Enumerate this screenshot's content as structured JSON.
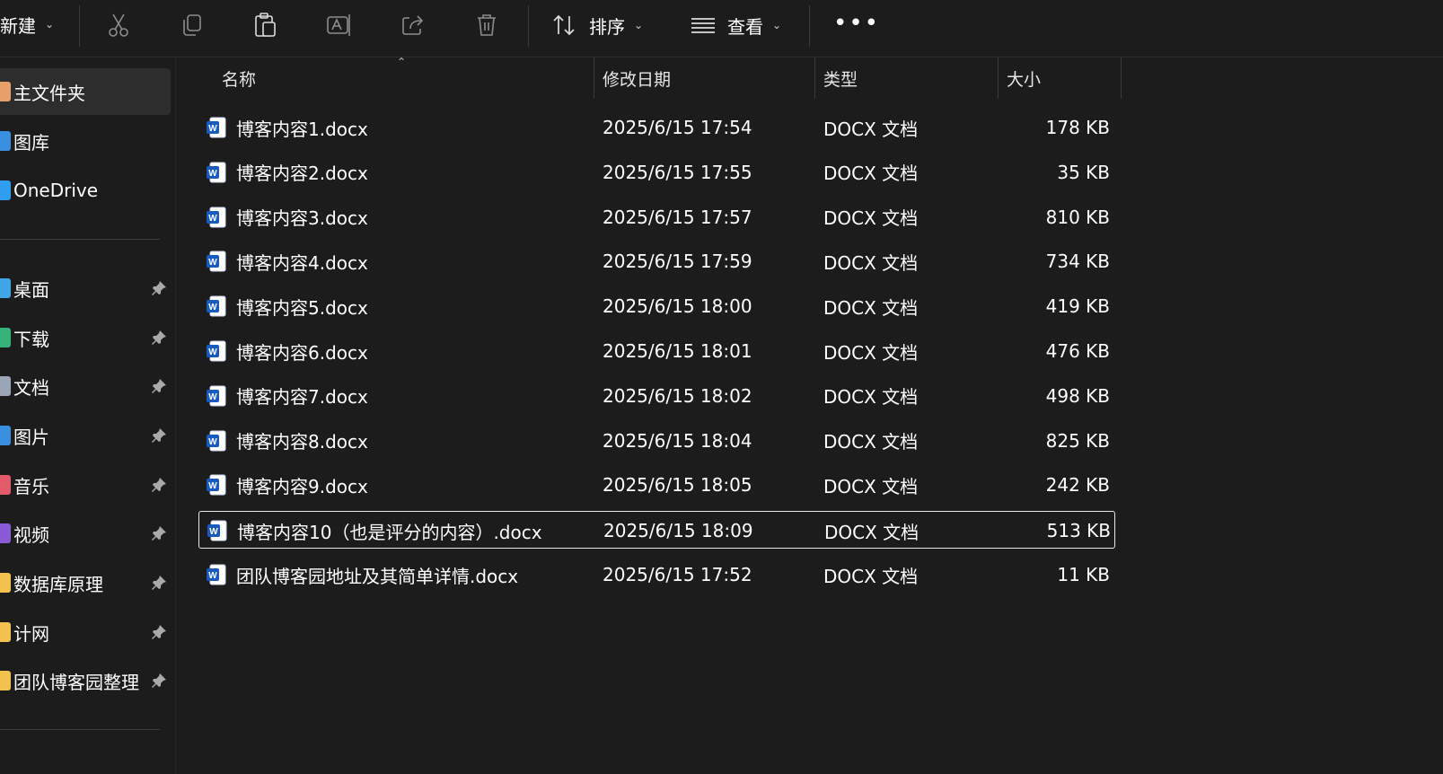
{
  "toolbar": {
    "new_label": "新建",
    "sort_label": "排序",
    "view_label": "查看",
    "icons": [
      "cut-icon",
      "copy-icon",
      "paste-icon",
      "rename-icon",
      "share-icon",
      "delete-icon",
      "sort-icon",
      "view-icon",
      "more-icon"
    ]
  },
  "sidebar": {
    "items": [
      {
        "label": "主文件夹",
        "icon": "home-icon",
        "color": "#e8a06a",
        "active": true
      },
      {
        "label": "图库",
        "icon": "gallery-icon",
        "color": "#3b8fe0"
      },
      {
        "label": "OneDrive",
        "icon": "cloud-icon",
        "color": "#2f9ef0"
      },
      {
        "label": "桌面",
        "icon": "desktop-icon",
        "color": "#3fa5e8",
        "pinned": true
      },
      {
        "label": "下载",
        "icon": "download-icon",
        "color": "#35b37a",
        "pinned": true
      },
      {
        "label": "文档",
        "icon": "documents-icon",
        "color": "#9aa6b8",
        "pinned": true
      },
      {
        "label": "图片",
        "icon": "pictures-icon",
        "color": "#3b8fe0",
        "pinned": true
      },
      {
        "label": "音乐",
        "icon": "music-icon",
        "color": "#e35a6b",
        "pinned": true
      },
      {
        "label": "视频",
        "icon": "videos-icon",
        "color": "#8a5bd6",
        "pinned": true
      },
      {
        "label": "数据库原理",
        "icon": "folder-icon",
        "color": "#f2c14e",
        "pinned": true
      },
      {
        "label": "计网",
        "icon": "folder-icon",
        "color": "#f2c14e",
        "pinned": true
      },
      {
        "label": "团队博客园整理",
        "icon": "folder-icon",
        "color": "#f2c14e",
        "pinned": true
      }
    ]
  },
  "columns": {
    "name": "名称",
    "date": "修改日期",
    "type": "类型",
    "size": "大小"
  },
  "files": [
    {
      "name": "博客内容1.docx",
      "date": "2025/6/15 17:54",
      "type": "DOCX 文档",
      "size": "178 KB"
    },
    {
      "name": "博客内容2.docx",
      "date": "2025/6/15 17:55",
      "type": "DOCX 文档",
      "size": "35 KB"
    },
    {
      "name": "博客内容3.docx",
      "date": "2025/6/15 17:57",
      "type": "DOCX 文档",
      "size": "810 KB"
    },
    {
      "name": "博客内容4.docx",
      "date": "2025/6/15 17:59",
      "type": "DOCX 文档",
      "size": "734 KB"
    },
    {
      "name": "博客内容5.docx",
      "date": "2025/6/15 18:00",
      "type": "DOCX 文档",
      "size": "419 KB"
    },
    {
      "name": "博客内容6.docx",
      "date": "2025/6/15 18:01",
      "type": "DOCX 文档",
      "size": "476 KB"
    },
    {
      "name": "博客内容7.docx",
      "date": "2025/6/15 18:02",
      "type": "DOCX 文档",
      "size": "498 KB"
    },
    {
      "name": "博客内容8.docx",
      "date": "2025/6/15 18:04",
      "type": "DOCX 文档",
      "size": "825 KB"
    },
    {
      "name": "博客内容9.docx",
      "date": "2025/6/15 18:05",
      "type": "DOCX 文档",
      "size": "242 KB"
    },
    {
      "name": "博客内容10（也是评分的内容）.docx",
      "date": "2025/6/15 18:09",
      "type": "DOCX 文档",
      "size": "513 KB",
      "selected": true
    },
    {
      "name": "团队博客园地址及其简单详情.docx",
      "date": "2025/6/15 17:52",
      "type": "DOCX 文档",
      "size": "11 KB"
    }
  ]
}
